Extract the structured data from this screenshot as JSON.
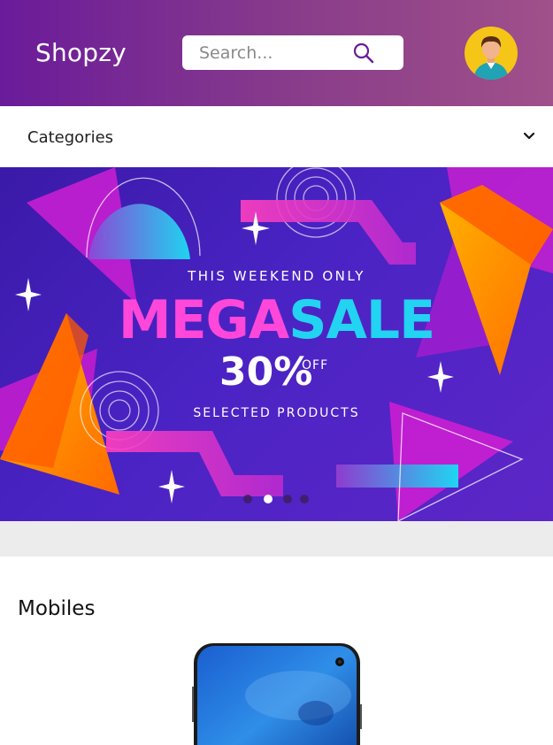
{
  "header": {
    "logo": "Shopzy",
    "search_placeholder": "Search..."
  },
  "categories": {
    "label": "Categories"
  },
  "banner": {
    "line1": "THIS WEEKEND ONLY",
    "mega_part1": "MEGA",
    "mega_part2": "SALE",
    "percent": "30%",
    "off": "OFF",
    "line3": "SELECTED PRODUCTS",
    "slides": 4,
    "active_slide": 1
  },
  "section": {
    "title": "Mobiles"
  },
  "colors": {
    "header_start": "#6a1b9a",
    "header_end": "#a0508a",
    "mega_pink": "#ff47d9",
    "mega_cyan": "#22d3f2",
    "avatar_bg": "#f5c518"
  },
  "icons": {
    "search": "search-icon",
    "dropdown": "chevron-down-icon",
    "avatar": "user-avatar-icon"
  }
}
